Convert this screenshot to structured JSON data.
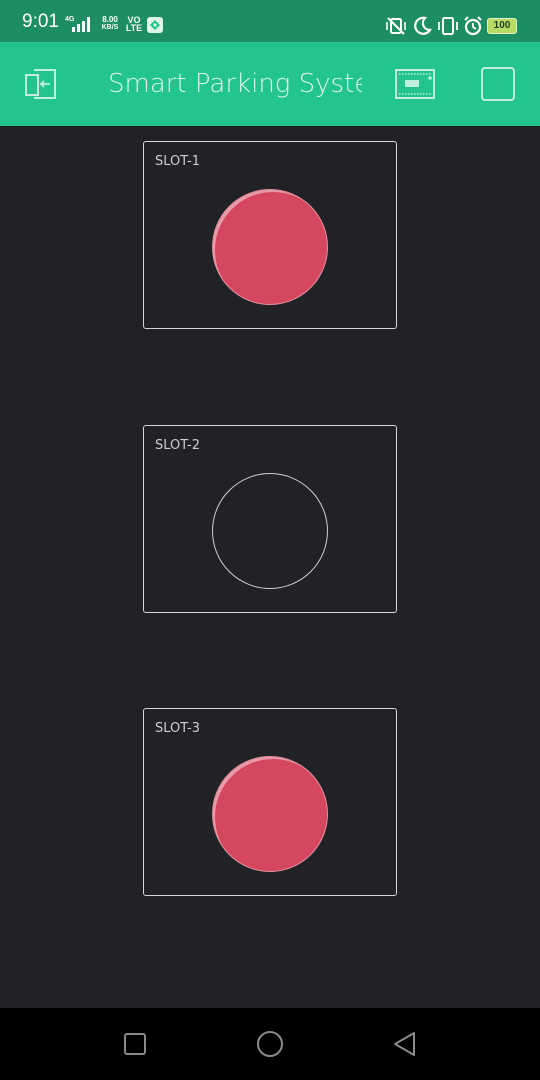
{
  "status_bar": {
    "time": "9:01",
    "network": "4G",
    "speed_value": "8.00",
    "speed_unit": "KB/S",
    "volte_top": "VO",
    "volte_bottom": "LTE",
    "battery": "100",
    "icons": [
      "signal-icon",
      "app-notification-icon",
      "vibrate-off-icon",
      "moon-icon",
      "vibrate-icon",
      "alarm-icon",
      "battery-icon"
    ]
  },
  "app_bar": {
    "title": "Smart Parking System",
    "left_icon": "exit-icon",
    "right_icons": [
      "device-icon",
      "stop-icon"
    ],
    "color": "#23c48e"
  },
  "slots": [
    {
      "label": "SLOT-1",
      "led_state": "on",
      "led_color": "#d4475f"
    },
    {
      "label": "SLOT-2",
      "led_state": "off",
      "led_color": "#d4475f"
    },
    {
      "label": "SLOT-3",
      "led_state": "on",
      "led_color": "#d4475f"
    }
  ],
  "nav_bar": {
    "icons": [
      "recents-icon",
      "home-icon",
      "back-icon"
    ]
  },
  "colors": {
    "background": "#212226",
    "status_bar": "#1d8d63",
    "accent": "#23c48e"
  }
}
